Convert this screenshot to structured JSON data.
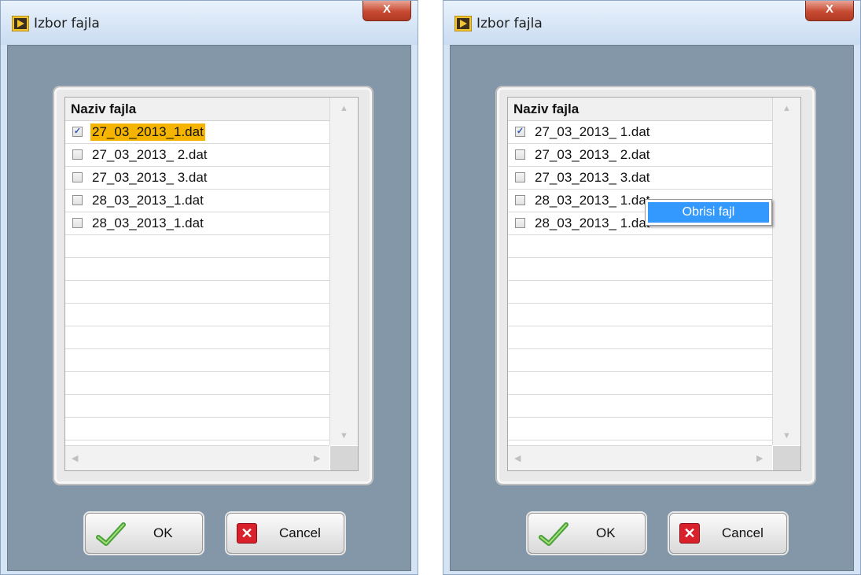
{
  "windows": [
    {
      "title": "Izbor fajla",
      "close_glyph": "X",
      "list": {
        "header": "Naziv fajla",
        "items": [
          {
            "label": "27_03_2013_1.dat",
            "checked": true,
            "check_glyph": "✓",
            "highlighted": true
          },
          {
            "label": "27_03_2013_ 2.dat",
            "checked": false,
            "check_glyph": "",
            "highlighted": false
          },
          {
            "label": "27_03_2013_ 3.dat",
            "checked": false,
            "check_glyph": "",
            "highlighted": false
          },
          {
            "label": "28_03_2013_1.dat",
            "checked": false,
            "check_glyph": "",
            "highlighted": false
          },
          {
            "label": "28_03_2013_1.dat",
            "checked": false,
            "check_glyph": "",
            "highlighted": false
          }
        ]
      },
      "buttons": {
        "ok": "OK",
        "cancel": "Cancel"
      }
    },
    {
      "title": "Izbor fajla",
      "close_glyph": "X",
      "list": {
        "header": "Naziv fajla",
        "items": [
          {
            "label": "27_03_2013_ 1.dat",
            "checked": true,
            "check_glyph": "✓",
            "highlighted": false
          },
          {
            "label": "27_03_2013_ 2.dat",
            "checked": false,
            "check_glyph": "",
            "highlighted": false
          },
          {
            "label": "27_03_2013_ 3.dat",
            "checked": false,
            "check_glyph": "",
            "highlighted": false
          },
          {
            "label": "28_03_2013_ 1.dat",
            "checked": false,
            "check_glyph": "",
            "highlighted": false
          },
          {
            "label": "28_03_2013_ 1.dat",
            "checked": false,
            "check_glyph": "",
            "highlighted": false
          }
        ]
      },
      "buttons": {
        "ok": "OK",
        "cancel": "Cancel"
      },
      "context_menu": {
        "items": [
          "Obrisi fajl"
        ]
      }
    }
  ],
  "colors": {
    "client_bg": "#8497a8",
    "selection": "#f4b400",
    "menu_highlight": "#3399ff",
    "close_button": "#c74a32"
  }
}
